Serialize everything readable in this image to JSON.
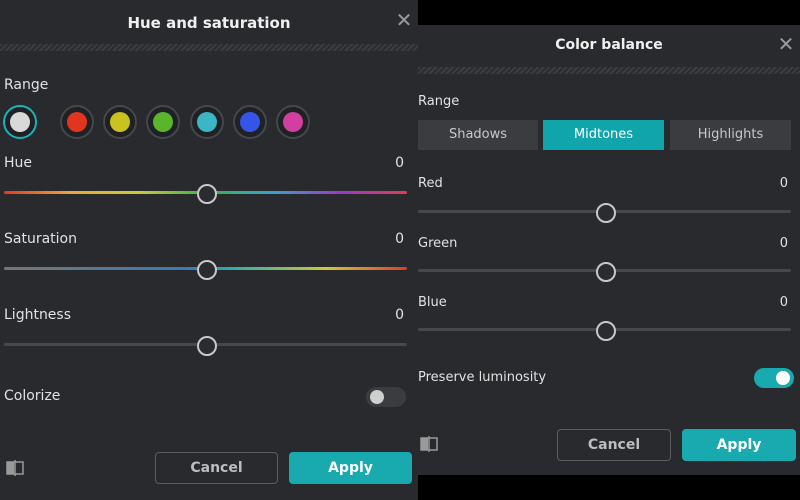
{
  "hue_saturation": {
    "title": "Hue and saturation",
    "range_label": "Range",
    "swatches": [
      {
        "name": "all",
        "color": "#d9d9d9",
        "selected": true
      },
      {
        "name": "red",
        "color": "#e2351e"
      },
      {
        "name": "yellow",
        "color": "#c9c21f"
      },
      {
        "name": "green",
        "color": "#5ab52d"
      },
      {
        "name": "cyan",
        "color": "#3bb6c5"
      },
      {
        "name": "blue",
        "color": "#3456e8"
      },
      {
        "name": "magenta",
        "color": "#d23fa0"
      }
    ],
    "hue": {
      "label": "Hue",
      "value": "0"
    },
    "saturation": {
      "label": "Saturation",
      "value": "0"
    },
    "lightness": {
      "label": "Lightness",
      "value": "0"
    },
    "colorize": {
      "label": "Colorize",
      "on": false
    },
    "cancel_label": "Cancel",
    "apply_label": "Apply"
  },
  "color_balance": {
    "title": "Color balance",
    "range_label": "Range",
    "tabs": [
      {
        "label": "Shadows",
        "active": false
      },
      {
        "label": "Midtones",
        "active": true
      },
      {
        "label": "Highlights",
        "active": false
      }
    ],
    "red": {
      "label": "Red",
      "value": "0"
    },
    "green": {
      "label": "Green",
      "value": "0"
    },
    "blue": {
      "label": "Blue",
      "value": "0"
    },
    "preserve": {
      "label": "Preserve luminosity",
      "on": true
    },
    "cancel_label": "Cancel",
    "apply_label": "Apply"
  },
  "colors": {
    "accent": "#19aab0",
    "panel": "#282a2e"
  }
}
